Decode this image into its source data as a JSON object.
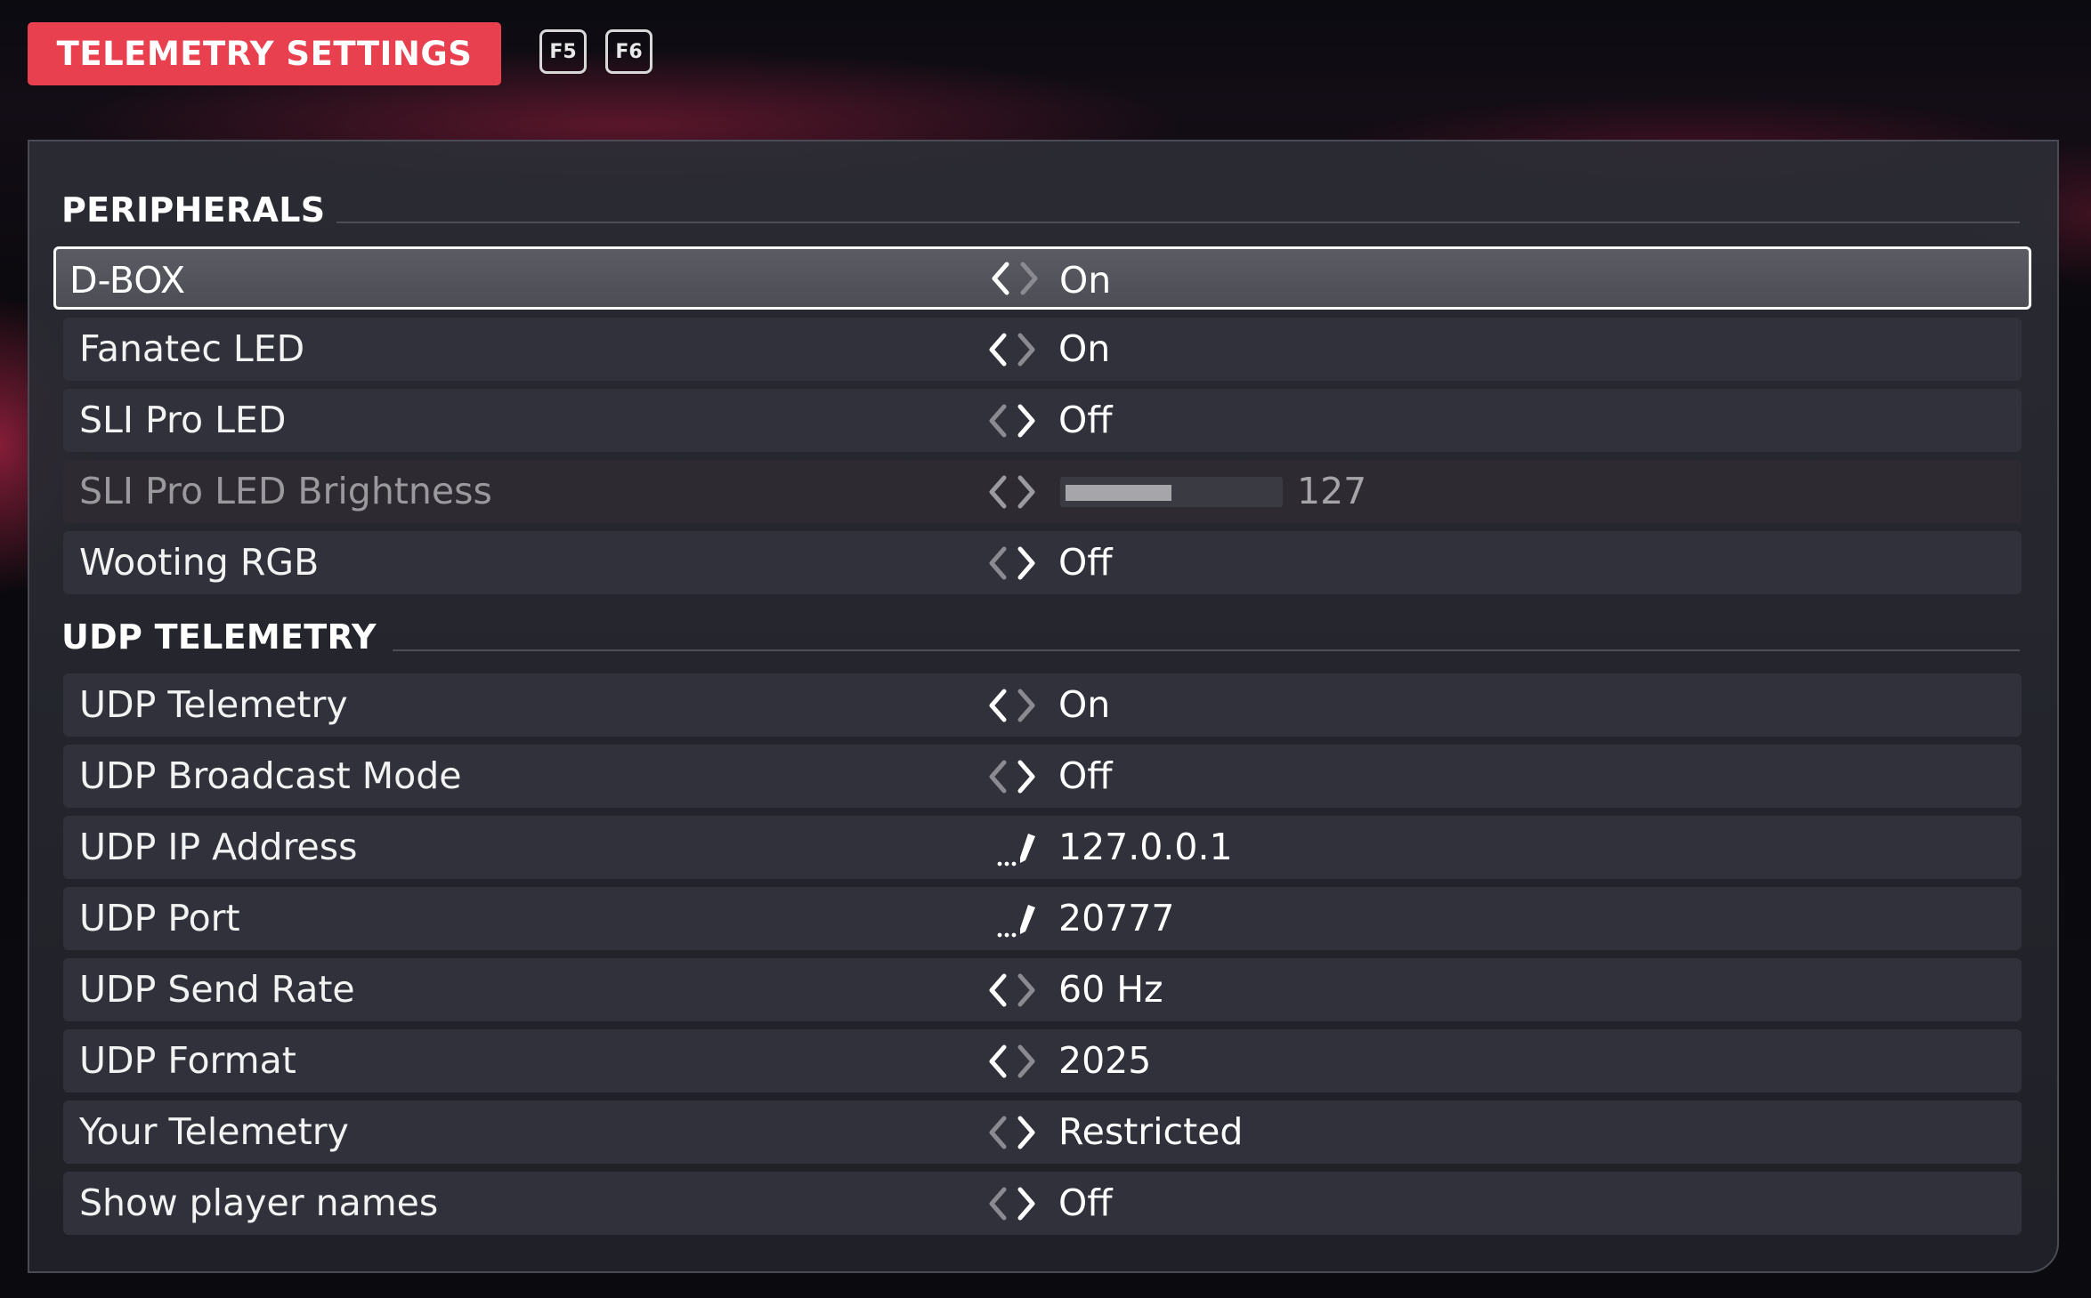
{
  "header": {
    "title": "TELEMETRY SETTINGS",
    "keys": [
      "F5",
      "F6"
    ]
  },
  "colors": {
    "accent": "#e8404f",
    "panel": "#2c2d35",
    "row": "#30313a",
    "selected_border": "#ffffff"
  },
  "sections": [
    {
      "title": "PERIPHERALS",
      "rows": [
        {
          "label": "D-BOX",
          "control": "arrows",
          "value": "On",
          "selected": true
        },
        {
          "label": "Fanatec LED",
          "control": "arrows",
          "value": "On"
        },
        {
          "label": "SLI Pro LED",
          "control": "arrows",
          "value": "Off"
        },
        {
          "label": "SLI Pro LED Brightness",
          "control": "slider",
          "value": "127",
          "fraction": 0.5,
          "disabled": true
        },
        {
          "label": "Wooting RGB",
          "control": "arrows",
          "value": "Off"
        }
      ]
    },
    {
      "title": "UDP TELEMETRY",
      "rows": [
        {
          "label": "UDP Telemetry",
          "control": "arrows",
          "value": "On"
        },
        {
          "label": "UDP Broadcast Mode",
          "control": "arrows",
          "value": "Off"
        },
        {
          "label": "UDP IP Address",
          "control": "edit",
          "value": "127.0.0.1"
        },
        {
          "label": "UDP Port",
          "control": "edit",
          "value": "20777"
        },
        {
          "label": "UDP Send Rate",
          "control": "arrows",
          "value": "60 Hz"
        },
        {
          "label": "UDP Format",
          "control": "arrows",
          "value": "2025"
        },
        {
          "label": "Your Telemetry",
          "control": "arrows",
          "value": "Restricted"
        },
        {
          "label": "Show player names",
          "control": "arrows",
          "value": "Off"
        }
      ]
    }
  ],
  "icons": {
    "left_arrow": "chevron-left-icon",
    "right_arrow": "chevron-right-icon",
    "edit": "pencil-icon"
  }
}
